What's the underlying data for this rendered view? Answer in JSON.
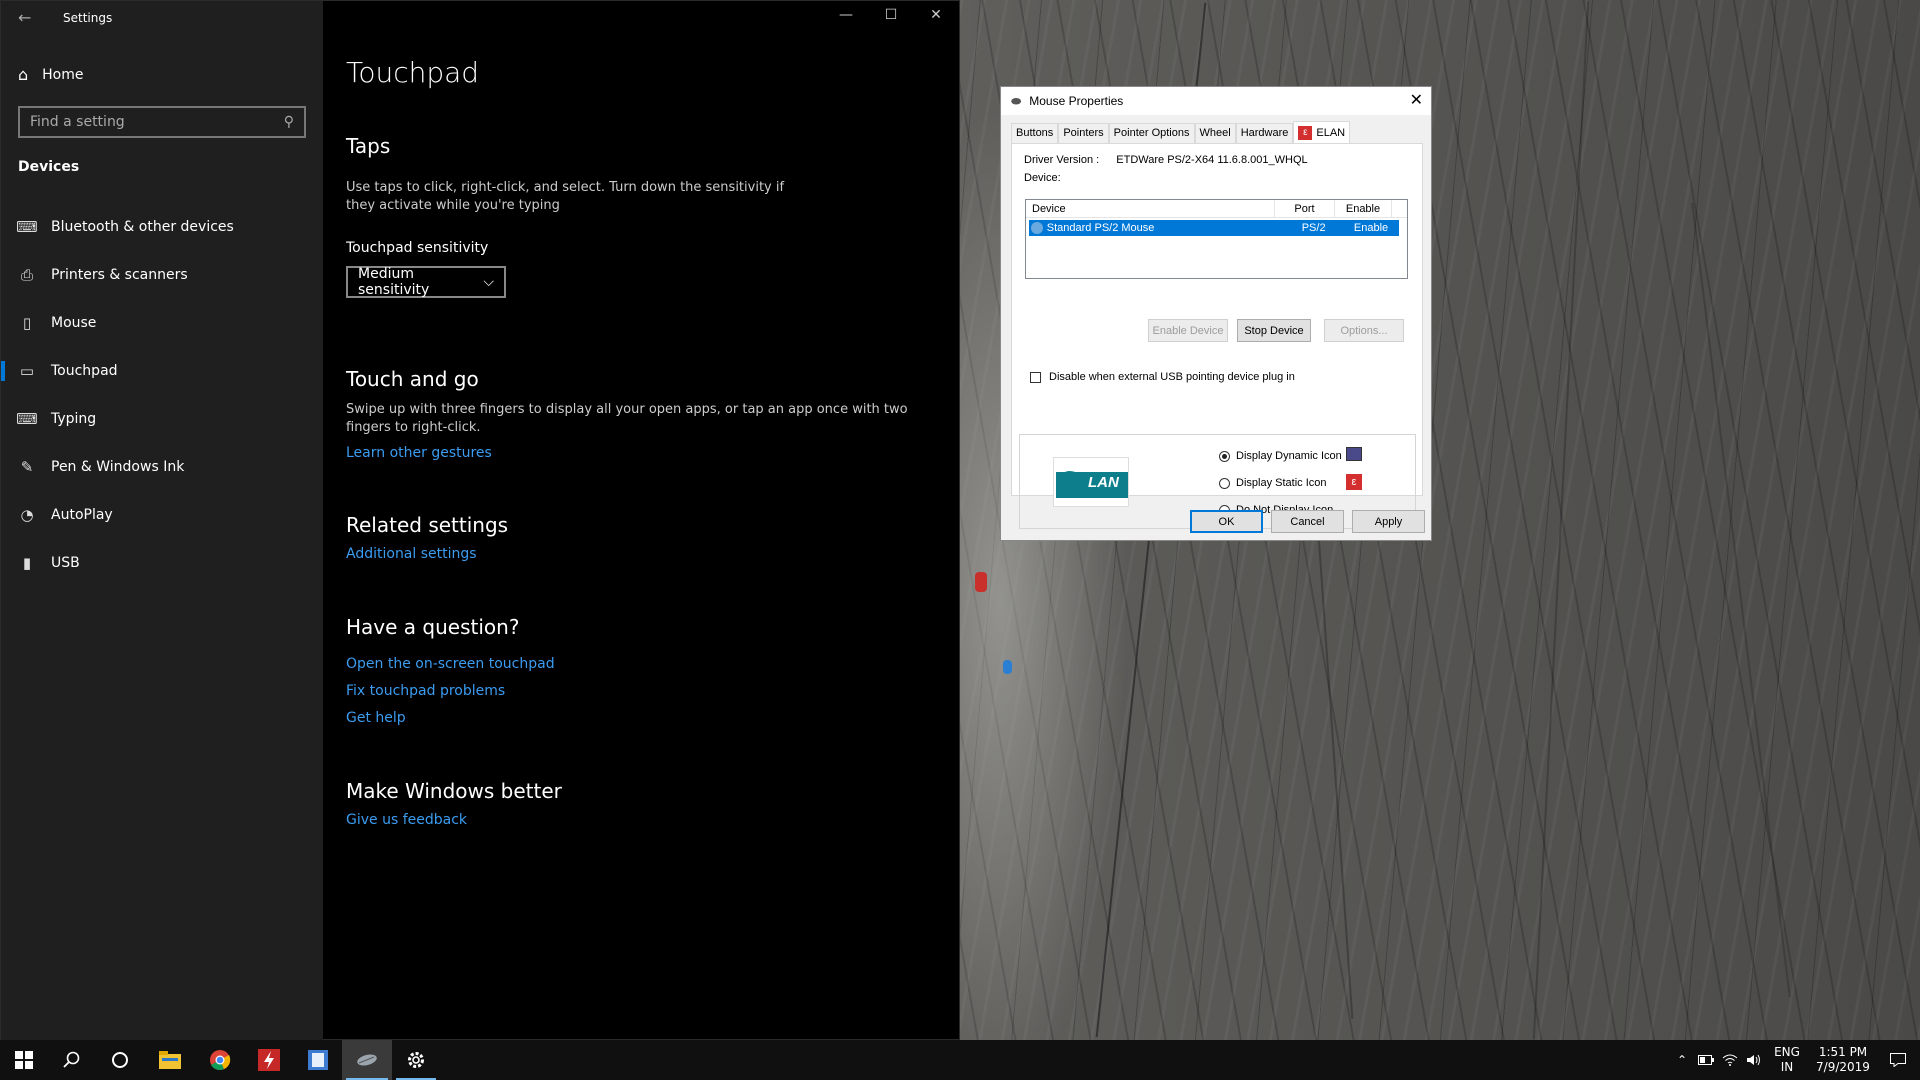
{
  "settings": {
    "window_title": "Settings",
    "nav": {
      "home": "Home",
      "search_placeholder": "Find a setting",
      "section": "Devices",
      "items": [
        {
          "label": "Bluetooth & other devices",
          "icon": "bluetooth-devices-icon"
        },
        {
          "label": "Printers & scanners",
          "icon": "printer-icon"
        },
        {
          "label": "Mouse",
          "icon": "mouse-icon"
        },
        {
          "label": "Touchpad",
          "icon": "touchpad-icon",
          "active": true
        },
        {
          "label": "Typing",
          "icon": "keyboard-icon"
        },
        {
          "label": "Pen & Windows Ink",
          "icon": "pen-icon"
        },
        {
          "label": "AutoPlay",
          "icon": "autoplay-icon"
        },
        {
          "label": "USB",
          "icon": "usb-icon"
        }
      ]
    },
    "content": {
      "title": "Touchpad",
      "taps": {
        "heading": "Taps",
        "description": "Use taps to click, right-click, and select. Turn down the sensitivity if they activate while you're typing",
        "sensitivity_label": "Touchpad sensitivity",
        "sensitivity_value": "Medium sensitivity"
      },
      "touch_and_go": {
        "heading": "Touch and go",
        "description": "Swipe up with three fingers to display all your open apps, or tap an app once with two fingers to right-click.",
        "link": "Learn other gestures"
      },
      "related": {
        "heading": "Related settings",
        "link": "Additional settings"
      },
      "question": {
        "heading": "Have a question?",
        "links": [
          "Open the on-screen touchpad",
          "Fix touchpad problems",
          "Get help"
        ]
      },
      "feedback": {
        "heading": "Make Windows better",
        "link": "Give us feedback"
      }
    }
  },
  "dialog": {
    "title": "Mouse Properties",
    "tabs": [
      "Buttons",
      "Pointers",
      "Pointer Options",
      "Wheel",
      "Hardware",
      "ELAN"
    ],
    "active_tab": "ELAN",
    "driver_label": "Driver Version :",
    "driver_value": "ETDWare PS/2-X64 11.6.8.001_WHQL",
    "device_label": "Device:",
    "columns": [
      "Device",
      "Port",
      "Enable"
    ],
    "rows": [
      {
        "device": "Standard PS/2 Mouse",
        "port": "PS/2",
        "enable": "Enable"
      }
    ],
    "buttons": {
      "enable": "Enable Device",
      "stop": "Stop Device",
      "options": "Options..."
    },
    "checkbox_label": "Disable when external USB pointing device plug in",
    "logo_text": "LAN",
    "icon_options": [
      {
        "label": "Display Dynamic Icon",
        "selected": true
      },
      {
        "label": "Display Static Icon",
        "selected": false
      },
      {
        "label": "Do Not Display Icon",
        "selected": false
      }
    ],
    "footer": {
      "ok": "OK",
      "cancel": "Cancel",
      "apply": "Apply"
    }
  },
  "taskbar": {
    "apps": [
      "windows-start-icon",
      "search-icon",
      "cortana-icon",
      "file-explorer-icon",
      "chrome-icon",
      "flash-app-icon",
      "notepad-app-icon",
      "mouse-properties-icon",
      "settings-gear-icon"
    ],
    "tray": {
      "language": "ENG",
      "region": "IN",
      "time": "1:51 PM",
      "date": "7/9/2019"
    }
  },
  "colors": {
    "accent": "#0078d7",
    "link": "#3b9cf0",
    "nav_bg": "#1f1f1f",
    "content_bg": "#000000"
  }
}
